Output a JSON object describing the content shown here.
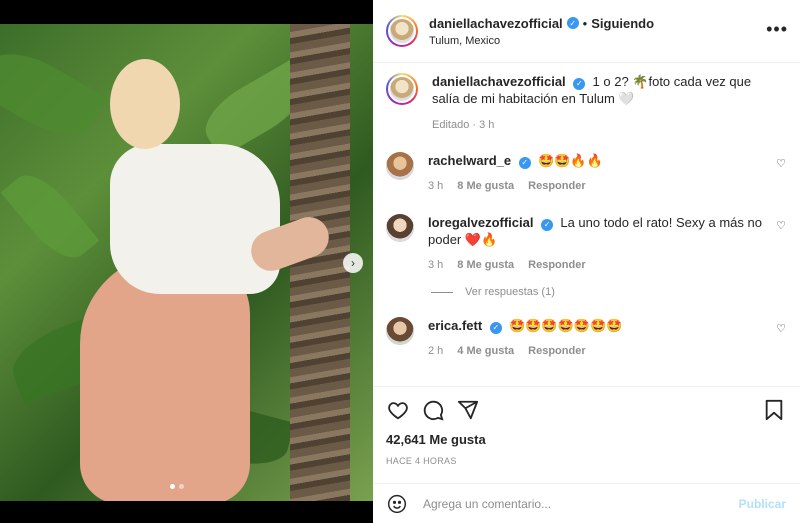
{
  "header": {
    "username": "daniellachavezofficial",
    "bullet": "•",
    "follow_label": "Siguiendo",
    "location": "Tulum, Mexico",
    "more_label": "•••"
  },
  "caption": {
    "username": "daniellachavezofficial",
    "text": "1 o 2? 🌴foto cada vez que salía de mi habitación en Tulum 🤍",
    "meta": "Editado · 3 h"
  },
  "comments": [
    {
      "username": "rachelward_e",
      "text": "🤩🤩🔥🔥",
      "time": "3 h",
      "likes": "8 Me gusta",
      "reply": "Responder"
    },
    {
      "username": "loregalvezofficial",
      "text": "La uno todo el rato! Sexy a más no poder ❤️🔥",
      "time": "3 h",
      "likes": "8 Me gusta",
      "reply": "Responder",
      "view_replies": "Ver respuestas (1)"
    },
    {
      "username": "erica.fett",
      "text": "🤩🤩🤩🤩🤩🤩🤩",
      "time": "2 h",
      "likes": "4 Me gusta",
      "reply": "Responder"
    }
  ],
  "actions": {
    "likes": "42,641 Me gusta",
    "time": "HACE 4 HORAS"
  },
  "add_comment": {
    "placeholder": "Agrega un comentario...",
    "publish_label": "Publicar"
  },
  "icons": {
    "verified": "verified-badge-icon",
    "like": "heart-icon",
    "comment": "comment-icon",
    "share": "paper-plane-icon",
    "save": "bookmark-icon",
    "emoji": "emoji-icon",
    "next": "chevron-right-icon"
  },
  "colors": {
    "verified": "#3897f0",
    "secondary_text": "#8e8e8e",
    "publish_disabled": "#b2dffc"
  }
}
